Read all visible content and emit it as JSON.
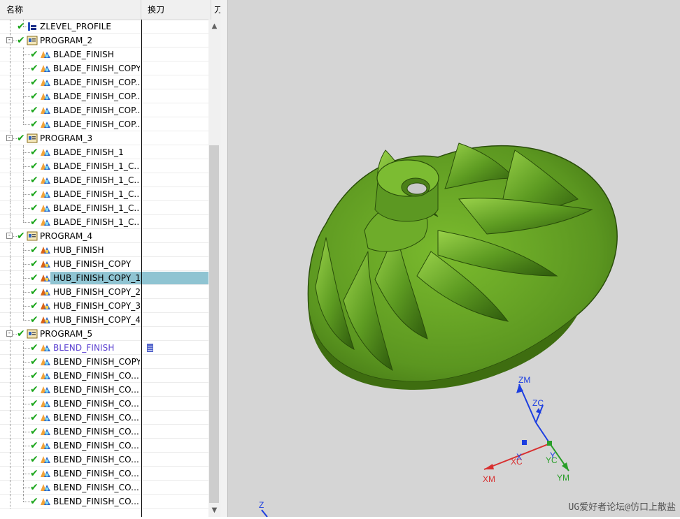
{
  "nav": {
    "columns": [
      "名称",
      "换刀",
      "刀"
    ],
    "rows": [
      {
        "label": "ZLEVEL_PROFILE",
        "level": 1,
        "icon": "zlevel-op-icon",
        "toggle": null,
        "selected": false,
        "highlight": false
      },
      {
        "label": "PROGRAM_2",
        "level": 0,
        "icon": "program-group-icon",
        "toggle": "-",
        "selected": false,
        "highlight": false
      },
      {
        "label": "BLADE_FINISH",
        "level": 1,
        "icon": "blade-finish-op-icon",
        "toggle": null,
        "selected": false,
        "highlight": false
      },
      {
        "label": "BLADE_FINISH_COPY",
        "level": 1,
        "icon": "blade-finish-op-icon",
        "toggle": null,
        "selected": false,
        "highlight": false
      },
      {
        "label": "BLADE_FINISH_COP...",
        "level": 1,
        "icon": "blade-finish-op-icon",
        "toggle": null,
        "selected": false,
        "highlight": false
      },
      {
        "label": "BLADE_FINISH_COP...",
        "level": 1,
        "icon": "blade-finish-op-icon",
        "toggle": null,
        "selected": false,
        "highlight": false
      },
      {
        "label": "BLADE_FINISH_COP...",
        "level": 1,
        "icon": "blade-finish-op-icon",
        "toggle": null,
        "selected": false,
        "highlight": false
      },
      {
        "label": "BLADE_FINISH_COP...",
        "level": 1,
        "icon": "blade-finish-op-icon",
        "toggle": null,
        "selected": false,
        "highlight": false
      },
      {
        "label": "PROGRAM_3",
        "level": 0,
        "icon": "program-group-icon",
        "toggle": "-",
        "selected": false,
        "highlight": false
      },
      {
        "label": "BLADE_FINISH_1",
        "level": 1,
        "icon": "blade-finish-op-icon",
        "toggle": null,
        "selected": false,
        "highlight": false
      },
      {
        "label": "BLADE_FINISH_1_C...",
        "level": 1,
        "icon": "blade-finish-op-icon",
        "toggle": null,
        "selected": false,
        "highlight": false
      },
      {
        "label": "BLADE_FINISH_1_C...",
        "level": 1,
        "icon": "blade-finish-op-icon",
        "toggle": null,
        "selected": false,
        "highlight": false
      },
      {
        "label": "BLADE_FINISH_1_C...",
        "level": 1,
        "icon": "blade-finish-op-icon",
        "toggle": null,
        "selected": false,
        "highlight": false
      },
      {
        "label": "BLADE_FINISH_1_C...",
        "level": 1,
        "icon": "blade-finish-op-icon",
        "toggle": null,
        "selected": false,
        "highlight": false
      },
      {
        "label": "BLADE_FINISH_1_C...",
        "level": 1,
        "icon": "blade-finish-op-icon",
        "toggle": null,
        "selected": false,
        "highlight": false
      },
      {
        "label": "PROGRAM_4",
        "level": 0,
        "icon": "program-group-icon",
        "toggle": "-",
        "selected": false,
        "highlight": false
      },
      {
        "label": "HUB_FINISH",
        "level": 1,
        "icon": "hub-finish-op-icon",
        "toggle": null,
        "selected": false,
        "highlight": false
      },
      {
        "label": "HUB_FINISH_COPY",
        "level": 1,
        "icon": "hub-finish-op-icon",
        "toggle": null,
        "selected": false,
        "highlight": false
      },
      {
        "label": "HUB_FINISH_COPY_1",
        "level": 1,
        "icon": "hub-finish-op-icon",
        "toggle": null,
        "selected": true,
        "highlight": false
      },
      {
        "label": "HUB_FINISH_COPY_2",
        "level": 1,
        "icon": "hub-finish-op-icon",
        "toggle": null,
        "selected": false,
        "highlight": false
      },
      {
        "label": "HUB_FINISH_COPY_3",
        "level": 1,
        "icon": "hub-finish-op-icon",
        "toggle": null,
        "selected": false,
        "highlight": false
      },
      {
        "label": "HUB_FINISH_COPY_4",
        "level": 1,
        "icon": "hub-finish-op-icon",
        "toggle": null,
        "selected": false,
        "highlight": false
      },
      {
        "label": "PROGRAM_5",
        "level": 0,
        "icon": "program-group-icon",
        "toggle": "-",
        "selected": false,
        "highlight": false
      },
      {
        "label": "BLEND_FINISH",
        "level": 1,
        "icon": "blend-finish-op-icon",
        "toggle": null,
        "selected": false,
        "highlight": true,
        "toolchange": true
      },
      {
        "label": "BLEND_FINISH_COPY",
        "level": 1,
        "icon": "blend-finish-op-icon",
        "toggle": null,
        "selected": false,
        "highlight": false
      },
      {
        "label": "BLEND_FINISH_CO...",
        "level": 1,
        "icon": "blend-finish-op-icon",
        "toggle": null,
        "selected": false,
        "highlight": false
      },
      {
        "label": "BLEND_FINISH_CO...",
        "level": 1,
        "icon": "blend-finish-op-icon",
        "toggle": null,
        "selected": false,
        "highlight": false
      },
      {
        "label": "BLEND_FINISH_CO...",
        "level": 1,
        "icon": "blend-finish-op-icon",
        "toggle": null,
        "selected": false,
        "highlight": false
      },
      {
        "label": "BLEND_FINISH_CO...",
        "level": 1,
        "icon": "blend-finish-op-icon",
        "toggle": null,
        "selected": false,
        "highlight": false
      },
      {
        "label": "BLEND_FINISH_CO...",
        "level": 1,
        "icon": "blend-finish-op-icon",
        "toggle": null,
        "selected": false,
        "highlight": false
      },
      {
        "label": "BLEND_FINISH_CO...",
        "level": 1,
        "icon": "blend-finish-op-icon",
        "toggle": null,
        "selected": false,
        "highlight": false
      },
      {
        "label": "BLEND_FINISH_CO...",
        "level": 1,
        "icon": "blend-finish-op-icon",
        "toggle": null,
        "selected": false,
        "highlight": false
      },
      {
        "label": "BLEND_FINISH_CO...",
        "level": 1,
        "icon": "blend-finish-op-icon",
        "toggle": null,
        "selected": false,
        "highlight": false
      },
      {
        "label": "BLEND_FINISH_CO...",
        "level": 1,
        "icon": "blend-finish-op-icon",
        "toggle": null,
        "selected": false,
        "highlight": false
      },
      {
        "label": "BLEND_FINISH_CO...",
        "level": 1,
        "icon": "blend-finish-op-icon",
        "toggle": null,
        "selected": false,
        "highlight": false
      }
    ],
    "scroll_up": "▲",
    "scroll_down": "▼"
  },
  "viewport": {
    "background": "#d5d5d5",
    "model_color": "#5f9a1e",
    "axes": {
      "zm": "ZM",
      "zc": "ZC",
      "xm": "XM",
      "xc": "XC",
      "ym": "YM",
      "yc": "YC",
      "x_small": "X",
      "y_small": "Y",
      "corner_z": "Z"
    },
    "watermark": "UG爱好者论坛@仿口上散盐"
  },
  "colors": {
    "selection": "#8fc4d2",
    "check_green": "#1aa51a",
    "highlight_text": "#5a3fd0",
    "axis_blue": "#1c3ee0",
    "axis_red": "#d83030",
    "axis_green": "#2a9e2a"
  }
}
